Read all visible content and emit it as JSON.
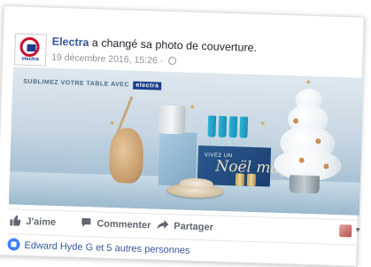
{
  "post": {
    "page_name": "Electra",
    "action_text": " a changé sa photo de couverture.",
    "timestamp": "19 décembre 2016, 15:26 ·",
    "logo_text": "electra"
  },
  "cover": {
    "banner_text": "SUBLIMEZ VOTRE TABLE AVEC",
    "brand_badge": "electra",
    "box_small_text": "VIVEZ UN",
    "box_script_text": "Noël magique"
  },
  "actions": {
    "like_label": "J'aime",
    "comment_label": "Commenter",
    "share_label": "Partager"
  },
  "reactions": {
    "summary": "Edward Hyde G et 5 autres personnes"
  },
  "colors": {
    "link_blue": "#365899",
    "like_blue": "#4080ff",
    "brand_red": "#c8102e",
    "brand_navy": "#1a3e8c"
  }
}
